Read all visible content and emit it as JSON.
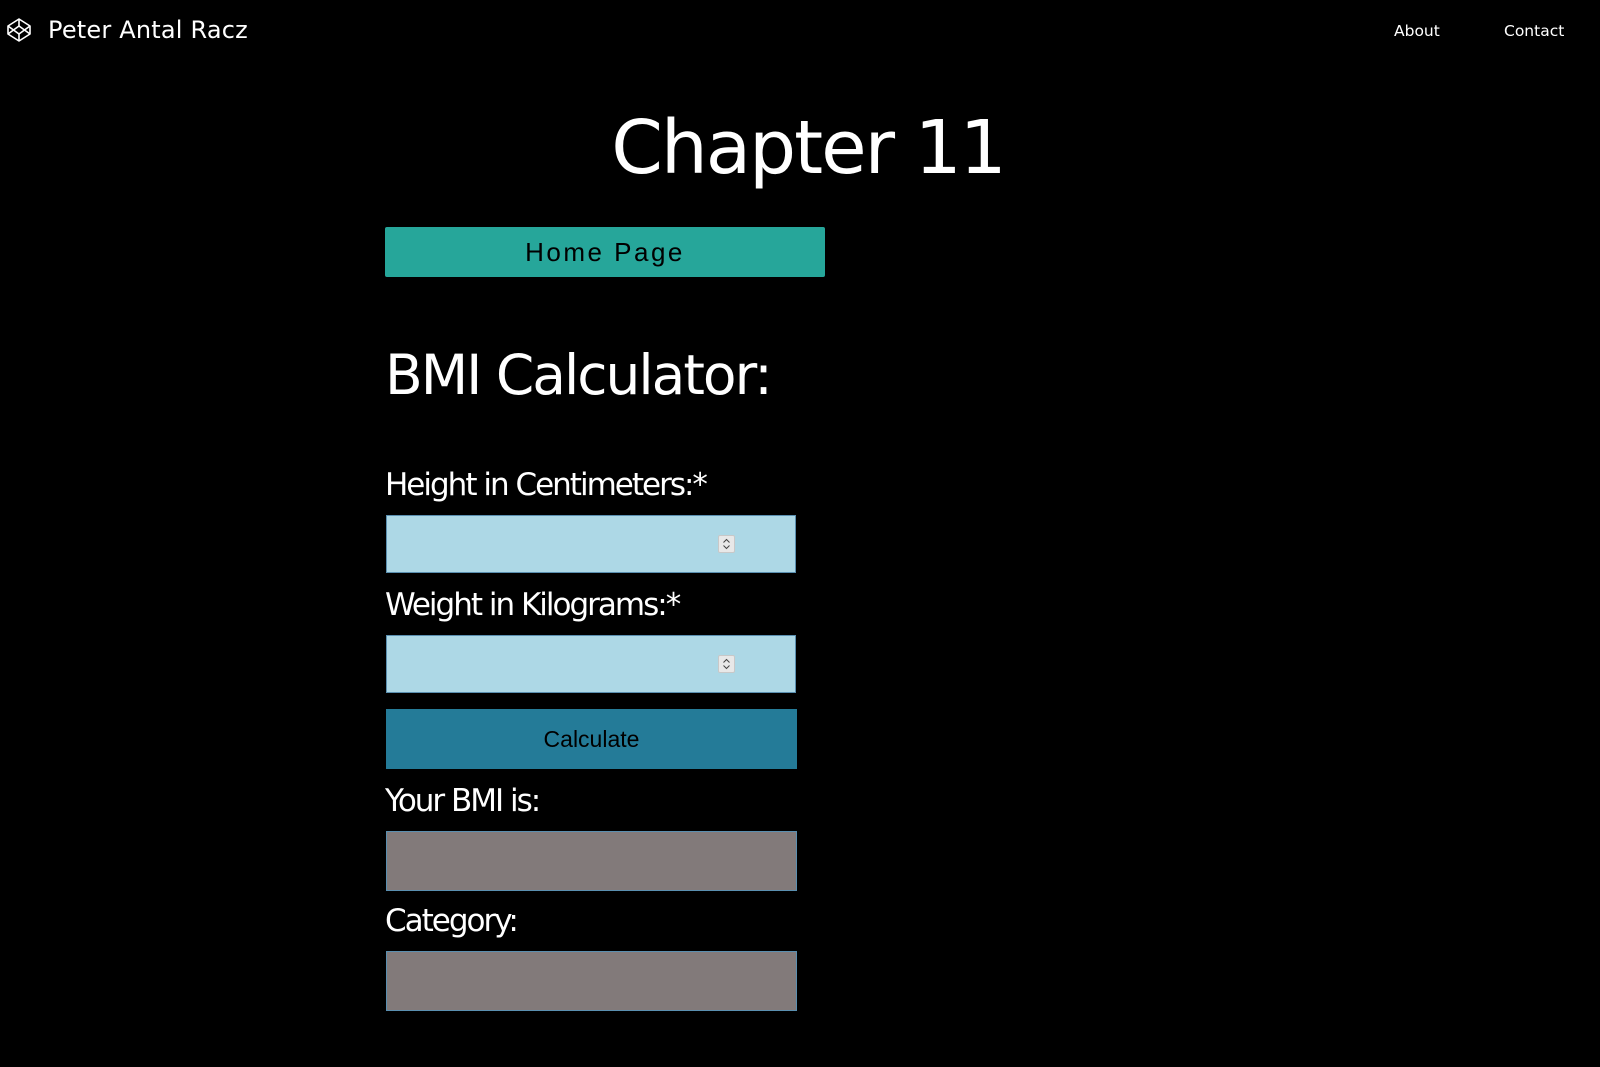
{
  "header": {
    "brand_name": "Peter Antal Racz",
    "brand_icon": "codepen-icon",
    "nav": {
      "about": "About",
      "contact": "Contact"
    }
  },
  "main": {
    "title": "Chapter 11",
    "home_button": "Home Page",
    "section_title": "BMI Calculator:",
    "form": {
      "height_label": "Height in Centimeters:*",
      "height_value": "",
      "weight_label": "Weight in Kilograms:*",
      "weight_value": "",
      "calculate_button": "Calculate",
      "bmi_label": "Your BMI is:",
      "bmi_value": "",
      "category_label": "Category:",
      "category_value": ""
    }
  },
  "colors": {
    "background": "#000000",
    "home_button": "#26a69a",
    "input_bg": "#add8e6",
    "calculate_button": "#247b98",
    "output_bg": "#827a7a"
  }
}
